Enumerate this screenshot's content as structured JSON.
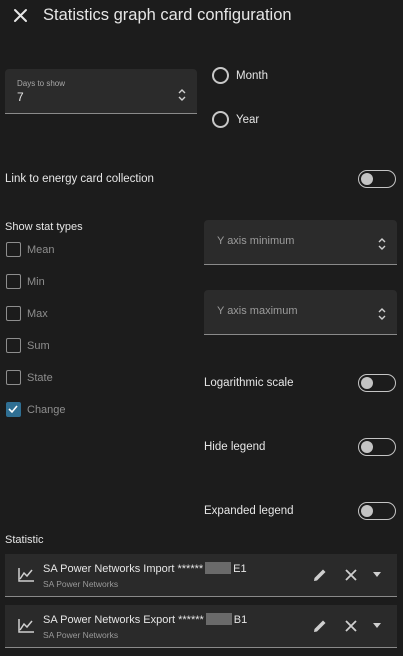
{
  "header": {
    "title": "Statistics graph card configuration"
  },
  "days_field": {
    "label": "Days to show",
    "value": "7"
  },
  "period": {
    "options": [
      {
        "label": "Month",
        "selected": false
      },
      {
        "label": "Year",
        "selected": false
      }
    ]
  },
  "energy_link": {
    "label": "Link to energy card collection",
    "on": false
  },
  "stat_types": {
    "heading": "Show stat types",
    "items": [
      {
        "label": "Mean",
        "checked": false
      },
      {
        "label": "Min",
        "checked": false
      },
      {
        "label": "Max",
        "checked": false
      },
      {
        "label": "Sum",
        "checked": false
      },
      {
        "label": "State",
        "checked": false
      },
      {
        "label": "Change",
        "checked": true
      }
    ]
  },
  "y_axis": {
    "min_placeholder": "Y axis minimum",
    "max_placeholder": "Y axis maximum"
  },
  "options": {
    "logarithmic": {
      "label": "Logarithmic scale",
      "on": false
    },
    "hide_legend": {
      "label": "Hide legend",
      "on": false
    },
    "expanded_legend": {
      "label": "Expanded legend",
      "on": false
    }
  },
  "statistics": {
    "heading": "Statistic",
    "rows": [
      {
        "title_pre": "SA Power Networks Import ******",
        "title_post": "E1",
        "subtitle": "SA Power Networks"
      },
      {
        "title_pre": "SA Power Networks Export ******",
        "title_post": "B1",
        "subtitle": "SA Power Networks"
      }
    ]
  },
  "colors": {
    "background": "#1c1c1c",
    "field": "#2b2b2b",
    "accent": "#2f6f93"
  }
}
